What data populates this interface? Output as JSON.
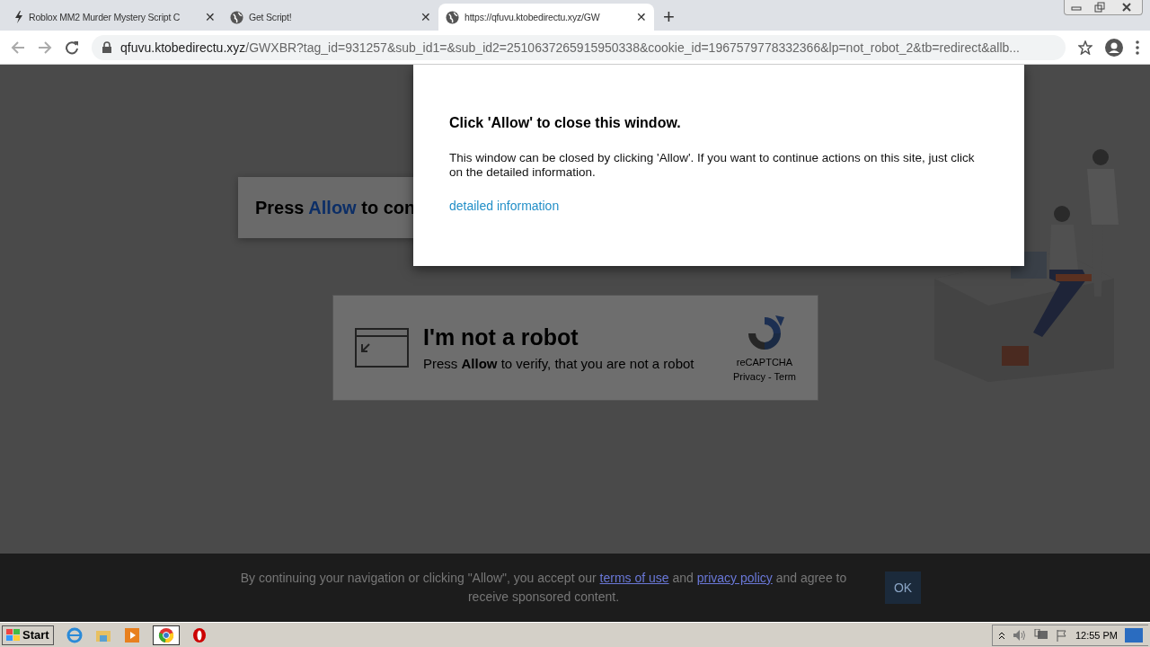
{
  "browser": {
    "tabs": [
      {
        "kind": "bolt",
        "title": "Roblox MM2 Murder Mystery Script C",
        "close": "✕",
        "selected": false
      },
      {
        "kind": "globe",
        "title": "Get Script!",
        "close": "✕",
        "selected": false
      },
      {
        "kind": "globe",
        "title": "https://qfuvu.ktobedirectu.xyz/GW",
        "close": "✕",
        "selected": true
      }
    ],
    "new_tab": "+",
    "address_bar": {
      "host": "qfuvu.ktobedirectu.xyz",
      "path": "/GWXBR?tag_id=931257&sub_id1=&sub_id2=2510637265915950338&cookie_id=1967579778332366&lp=not_robot_2&tb=redirect&allb..."
    }
  },
  "page": {
    "prompt": {
      "before": "Press",
      "highlight": "Allow",
      "after": "to con"
    },
    "captcha": {
      "title": "I'm not a robot",
      "text": "Press **Allow** to verify, that you are not a robot",
      "brand": "reCAPTCHA",
      "links": "Privacy - Term"
    }
  },
  "modal": {
    "title": "Click 'Allow' to close this window.",
    "body": "This window can be closed by clicking 'Allow'. If you want to continue actions on this site, just click on the detailed information.",
    "link": "detailed information"
  },
  "cookie_bar": {
    "before": "By continuing your navigation or clicking \"Allow\", you accept our",
    "link1": "terms of use",
    "middle": "and",
    "link2": "privacy policy",
    "after": "and agree to receive sponsored content.",
    "button": "OK"
  },
  "taskbar": {
    "start": "Start",
    "clock": "12:55 PM"
  }
}
